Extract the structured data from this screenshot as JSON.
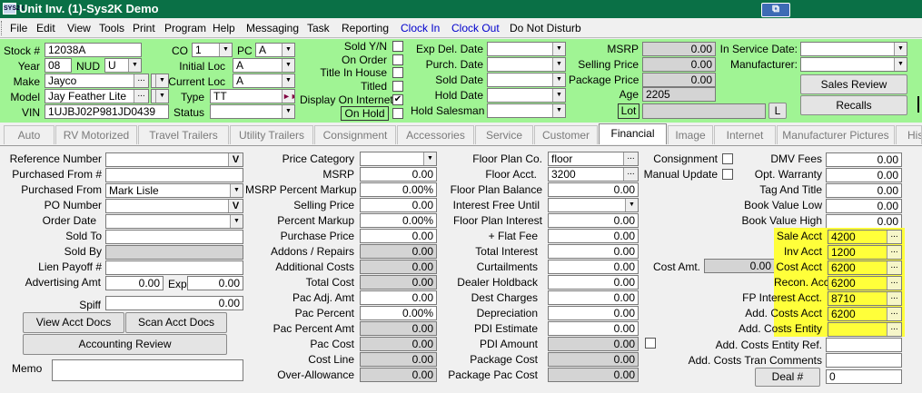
{
  "window": {
    "title": "Unit Inv. (1)-Sys2K Demo",
    "icon": "app-icon",
    "icon_text": "SYS2K"
  },
  "menu": [
    "File",
    "Edit",
    "View",
    "Tools",
    "Print",
    "Program",
    "Help",
    "Messaging",
    "Task",
    "Reporting",
    "Clock In",
    "Clock Out",
    "Do Not Disturb"
  ],
  "header": {
    "stock_label": "Stock #",
    "stock": "12038A",
    "year_label": "Year",
    "year": "08",
    "nud_label": "NUD",
    "nud": "U",
    "make_label": "Make",
    "make": "Jayco",
    "model_label": "Model",
    "model": "Jay Feather Lite",
    "vin_label": "VIN",
    "vin": "1UJBJ02P981JD0439",
    "co_label": "CO",
    "co": "1",
    "pc_label": "PC",
    "pc": "A",
    "initial_loc_label": "Initial Loc",
    "initial_loc": "A",
    "current_loc_label": "Current Loc",
    "current_loc": "A",
    "type_label": "Type",
    "type": "TT",
    "status_label": "Status",
    "status": "",
    "sold_yn_label": "Sold Y/N",
    "on_order_label": "On Order",
    "title_in_house_label": "Title In House",
    "titled_label": "Titled",
    "display_internet_label": "Display On Internet",
    "on_hold_label": "On Hold",
    "display_internet_checked": "✔",
    "exp_del_label": "Exp Del. Date",
    "purch_date_label": "Purch. Date",
    "sold_date_label": "Sold Date",
    "hold_date_label": "Hold Date",
    "hold_salesman_label": "Hold Salesman",
    "msrp_label": "MSRP",
    "msrp": "0.00",
    "selling_price_label": "Selling Price",
    "selling_price": "0.00",
    "package_price_label": "Package Price",
    "package_price": "0.00",
    "age_label": "Age",
    "age": "2205",
    "lot_label": "Lot",
    "l_label": "L",
    "in_service_label": "In Service Date:",
    "manufacturer_label": "Manufacturer:",
    "sales_review": "Sales Review",
    "recalls": "Recalls"
  },
  "tabs": [
    "Auto",
    "RV Motorized",
    "Travel Trailers",
    "Utility Trailers",
    "Consignment",
    "Accessories",
    "Service",
    "Customer",
    "Financial",
    "Image",
    "Internet",
    "Manufacturer Pictures",
    "His"
  ],
  "col1": {
    "reference_number_label": "Reference Number",
    "reference_btn": "V",
    "purchased_from_num_label": "Purchased From #",
    "purchased_from_label": "Purchased From",
    "purchased_from": "Mark Lisle",
    "po_number_label": "PO Number",
    "po_btn": "V",
    "order_date_label": "Order Date",
    "sold_to_label": "Sold To",
    "sold_by_label": "Sold By",
    "lien_payoff_label": "Lien Payoff #",
    "advertising_amt_label": "Advertising Amt",
    "advertising_amt": "0.00",
    "exp_label": "Exp",
    "exp": "0.00",
    "spiff_label": "Spiff",
    "spiff": "0.00",
    "view_acct_docs": "View Acct Docs",
    "scan_acct_docs": "Scan Acct Docs",
    "accounting_review": "Accounting Review",
    "memo_label": "Memo"
  },
  "col2": {
    "price_category_label": "Price Category",
    "msrp_label": "MSRP",
    "msrp": "0.00",
    "msrp_pct_label": "MSRP Percent Markup",
    "msrp_pct": "0.00%",
    "selling_price_label": "Selling Price",
    "selling_price": "0.00",
    "pct_markup_label": "Percent Markup",
    "pct_markup": "0.00%",
    "purchase_price_label": "Purchase Price",
    "purchase_price": "0.00",
    "addons_label": "Addons / Repairs",
    "addons": "0.00",
    "additional_costs_label": "Additional Costs",
    "additional_costs": "0.00",
    "total_cost_label": "Total Cost",
    "total_cost": "0.00",
    "pac_adj_label": "Pac Adj. Amt",
    "pac_adj": "0.00",
    "pac_percent_label": "Pac Percent",
    "pac_percent": "0.00%",
    "pac_percent_amt_label": "Pac Percent Amt",
    "pac_percent_amt": "0.00",
    "pac_cost_label": "Pac Cost",
    "pac_cost": "0.00",
    "cost_line_label": "Cost Line",
    "cost_line": "0.00",
    "over_allowance_label": "Over-Allowance",
    "over_allowance": "0.00"
  },
  "col3": {
    "floor_plan_co_label": "Floor Plan Co.",
    "floor_plan_co": "floor",
    "floor_acct_label": "Floor Acct.",
    "floor_acct": "3200",
    "floor_plan_balance_label": "Floor Plan Balance",
    "floor_plan_balance": "0.00",
    "interest_free_label": "Interest Free Until",
    "floor_plan_interest_label": "Floor Plan Interest",
    "floor_plan_interest": "0.00",
    "flat_fee_label": "+ Flat Fee",
    "flat_fee": "0.00",
    "total_interest_label": "Total Interest",
    "total_interest": "0.00",
    "curtailments_label": "Curtailments",
    "curtailments": "0.00",
    "dealer_holdback_label": "Dealer Holdback",
    "dealer_holdback": "0.00",
    "dest_charges_label": "Dest Charges",
    "dest_charges": "0.00",
    "depreciation_label": "Depreciation",
    "depreciation": "0.00",
    "pdi_estimate_label": "PDI Estimate",
    "pdi_estimate": "0.00",
    "pdi_amount_label": "PDI Amount",
    "pdi_amount": "0.00",
    "package_cost_label": "Package Cost",
    "package_cost": "0.00",
    "package_pac_cost_label": "Package Pac Cost",
    "package_pac_cost": "0.00"
  },
  "col4": {
    "consignment_label": "Consignment",
    "manual_update_label": "Manual Update",
    "cost_amt_label": "Cost Amt.",
    "cost_amt": "0.00",
    "dmv_fees_label": "DMV Fees",
    "dmv_fees": "0.00",
    "opt_warranty_label": "Opt. Warranty",
    "opt_warranty": "0.00",
    "tag_title_label": "Tag And Title",
    "tag_title": "0.00",
    "book_low_label": "Book Value Low",
    "book_low": "0.00",
    "book_high_label": "Book Value High",
    "book_high": "0.00",
    "sale_acct_label": "Sale Acct",
    "sale_acct": "4200",
    "inv_acct_label": "Inv Acct",
    "inv_acct": "1200",
    "cost_acct_label": "Cost Acct",
    "cost_acct": "6200",
    "recon_acct_label": "Recon. Acct",
    "recon_acct": "6200",
    "fp_interest_label": "FP Interest Acct.",
    "fp_interest": "8710",
    "add_costs_acct_label": "Add. Costs Acct",
    "add_costs_acct": "6200",
    "add_costs_entity_label": "Add. Costs Entity",
    "add_costs_entity_ref_label": "Add. Costs Entity Ref.",
    "add_costs_tran_label": "Add. Costs Tran Comments",
    "deal_btn": "Deal #",
    "deal": "0"
  },
  "colors": {
    "title_bar": "#0a7046",
    "header_panel": "#a0f494",
    "highlight": "#ffff3a",
    "clock_link": "#0000cc"
  }
}
